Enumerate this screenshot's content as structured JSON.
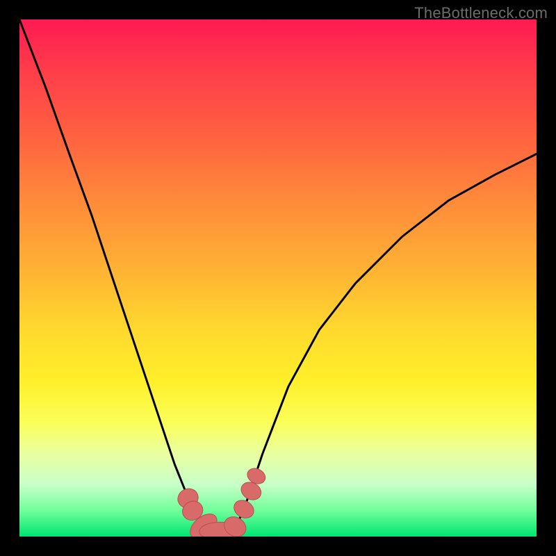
{
  "watermark": "TheBottleneck.com",
  "colors": {
    "background": "#000000",
    "gradient_top": "#ff1a53",
    "gradient_mid": "#ffd92e",
    "gradient_bottom": "#00e571",
    "curve": "#000000",
    "marker_fill": "#d86a6a",
    "marker_stroke": "#b94f4f"
  },
  "chart_data": {
    "type": "line",
    "title": "",
    "xlabel": "",
    "ylabel": "",
    "xlim": [
      0,
      1
    ],
    "ylim": [
      0,
      1
    ],
    "series": [
      {
        "name": "left-branch",
        "x": [
          0.0,
          0.05,
          0.1,
          0.14,
          0.18,
          0.22,
          0.25,
          0.28,
          0.3,
          0.32,
          0.34,
          0.355
        ],
        "y": [
          1.0,
          0.87,
          0.73,
          0.62,
          0.5,
          0.38,
          0.29,
          0.2,
          0.14,
          0.09,
          0.05,
          0.02
        ]
      },
      {
        "name": "flat-valley",
        "x": [
          0.355,
          0.37,
          0.4,
          0.42
        ],
        "y": [
          0.02,
          0.01,
          0.01,
          0.02
        ]
      },
      {
        "name": "right-branch",
        "x": [
          0.42,
          0.44,
          0.47,
          0.52,
          0.58,
          0.65,
          0.74,
          0.83,
          0.92,
          1.0
        ],
        "y": [
          0.02,
          0.07,
          0.16,
          0.29,
          0.4,
          0.49,
          0.58,
          0.65,
          0.7,
          0.74
        ]
      }
    ],
    "markers": [
      {
        "segment": "left",
        "cx": 0.326,
        "cy": 0.074,
        "rx": 0.018,
        "ry": 0.02,
        "rot": 64
      },
      {
        "segment": "left",
        "cx": 0.335,
        "cy": 0.05,
        "rx": 0.018,
        "ry": 0.02,
        "rot": 64
      },
      {
        "segment": "valley",
        "cx": 0.356,
        "cy": 0.02,
        "rx": 0.018,
        "ry": 0.03,
        "rot": 50
      },
      {
        "segment": "valley",
        "cx": 0.388,
        "cy": 0.01,
        "rx": 0.018,
        "ry": 0.04,
        "rot": 90
      },
      {
        "segment": "valley",
        "cx": 0.417,
        "cy": 0.019,
        "rx": 0.018,
        "ry": 0.022,
        "rot": 120
      },
      {
        "segment": "right",
        "cx": 0.434,
        "cy": 0.053,
        "rx": 0.016,
        "ry": 0.02,
        "rot": 120
      },
      {
        "segment": "right",
        "cx": 0.448,
        "cy": 0.088,
        "rx": 0.016,
        "ry": 0.02,
        "rot": 118
      },
      {
        "segment": "right",
        "cx": 0.458,
        "cy": 0.117,
        "rx": 0.014,
        "ry": 0.018,
        "rot": 116
      }
    ]
  }
}
